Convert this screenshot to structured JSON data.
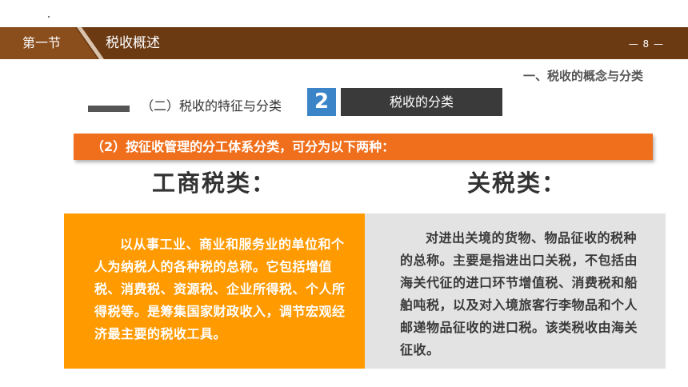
{
  "header": {
    "section_label": "第一节",
    "chapter_title": "税收概述",
    "page_number": "— 8 —"
  },
  "section_heading": "一、税收的概念与分类",
  "subheading": {
    "text": "（二）税收的特征与分类",
    "number": "2",
    "category_title": "税收的分类"
  },
  "banner": {
    "text": "（2）按征收管理的分工体系分类，可分为以下两种："
  },
  "left": {
    "heading": "工商税类：",
    "body": "以从事工业、商业和服务业的单位和个人为纳税人的各种税的总称。它包括增值税、消费税、资源税、企业所得税、个人所得税等。是筹集国家财政收入，调节宏观经济最主要的税收工具。"
  },
  "right": {
    "heading": "关税类：",
    "body": "对进出关境的货物、物品征收的税种的总称。主要是指进出口关税，不包括由海关代征的进口环节增值税、消费税和船舶吨税，以及对入境旅客行李物品和个人邮递物品征收的进口税。该类税收由海关征收。"
  },
  "colors": {
    "header_brown": "#6b3a13",
    "banner_orange": "#ef6f1c",
    "left_panel": "#ff9a00",
    "right_panel": "#e3e3e3",
    "number_blue": "#3b84c7"
  }
}
